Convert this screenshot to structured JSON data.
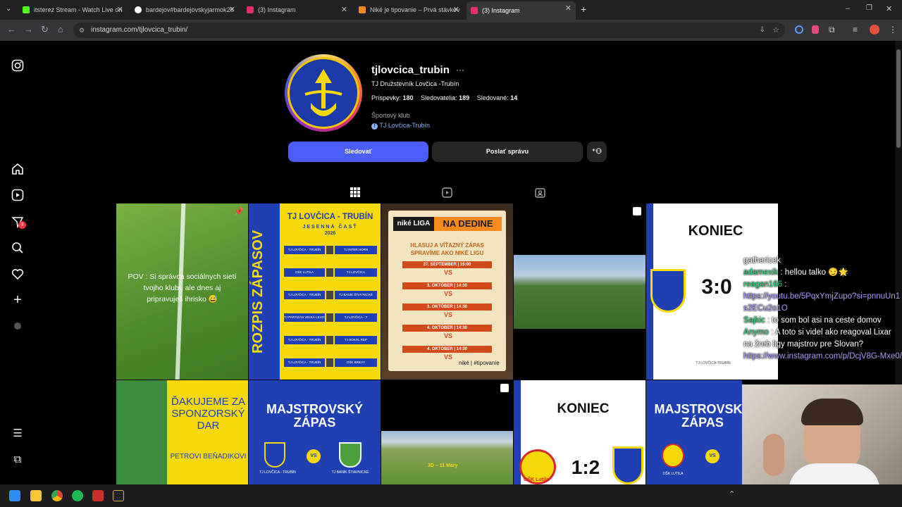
{
  "tabs": [
    {
      "label": "itsterez Stream - Watch Live on",
      "color": "#53fc18"
    },
    {
      "label": "bardejov#bardejovskyjarmok20",
      "color": "#ffffff"
    },
    {
      "label": "(3) Instagram",
      "color": "#e1306c"
    },
    {
      "label": "Niké je tipovanie – Prvá stávkov",
      "color": "#f58b1f"
    },
    {
      "label": "(3) Instagram",
      "color": "#e1306c"
    }
  ],
  "browser": {
    "url": "instagram.com/tjlovcica_trubin/"
  },
  "profile": {
    "username": "tjlovcica_trubin",
    "more": "···",
    "full_name": "TJ Družstevník Lovčica -Trubín",
    "posts_label": "Príspevky:",
    "posts_count": "180",
    "followers_label": "Sledovatelia:",
    "followers_count": "189",
    "following_label": "Sledované:",
    "following_count": "14",
    "category": "Športový klub",
    "link": "TJ Lovčica-Trubín",
    "follow_btn": "Sledovať",
    "message_btn": "Poslať správu"
  },
  "posts": {
    "p1": "POV : Si správca sociálnych sietí tvojho klubu ale dnes aj pripravuješ ihrisko 😅",
    "p2_title": "TJ LOVČICA - TRUBÍN",
    "p2_sub1": "JESENNÁ ČASŤ",
    "p2_sub2": "2026",
    "p2_side": "ROZPIS ZÁPASOV",
    "p2_matches": [
      {
        "home": "TJ LOVČICA - TRUBÍN",
        "away": "TJ INTER HORN"
      },
      {
        "home": "OŠK LUTILA",
        "away": "TJ LOVČICA"
      },
      {
        "home": "TJ LOVČICA - TRUBÍN",
        "away": "TJ BANÍK ŠTIAVNICKÉ"
      },
      {
        "home": "TJ PARTIZÁN VEĽKÁ LEHOTA",
        "away": "TJ LOVČICA - T"
      },
      {
        "home": "TJ LOVČICA - TRUBÍN",
        "away": "TJ SOKOL REP"
      },
      {
        "home": "TJ LOVČICA - TRUBÍN",
        "away": "OŠK BREHY"
      }
    ],
    "p3_brand": "niké LIGA",
    "p3_title": "NA DEDINE",
    "p3_sub": "HLASUJ A VÍŤAZNÝ ZÁPAS SPRAVÍME AKO NIKÉ LIGU",
    "p3_dates": [
      "27. SEPTEMBER | 15:00",
      "3. OKTÓBER | 14:30",
      "3. OKTÓBER | 14:30",
      "4. OKTÓBER | 14:30",
      "4. OKTÓBER | 14:30"
    ],
    "p3_footer": "niké | #tipovanie",
    "p5_title": "KONIEC",
    "p5_score": "3:0",
    "p5_club": "TJ LOVČICA-TRUBÍN",
    "p6_title": "ĎAKUJEME ZA SPONZORSKÝ DAR",
    "p6_name": "PETROVI BEŇADIKOVI",
    "p7_title": "MAJSTROVSKÝ ZÁPAS",
    "p7_vs": "VS",
    "p7_home": "TJ LOVČICA - TRUBÍN",
    "p7_away": "TJ BANÍK ŠTIAVNICKÉ",
    "p8_overlay": "3D – 11 Mary",
    "p9_title": "KONIEC",
    "p9_score": "1:2",
    "p9_club": "OŠK Lutila",
    "p10_title": "MAJSTROVSKÝ ZÁPAS",
    "p10_home": "OŠK LUTILA",
    "p10_vs": "VS"
  },
  "chat": [
    {
      "user": "",
      "text": "gathericek"
    },
    {
      "user": "adamexik",
      "text": ": hellou talko 😏🌟"
    },
    {
      "user": "reagan166",
      "text": ":",
      "link": "https://youtu.be/5PqxYmjZupo?si=pnnuUn1s2ECu2o1O"
    },
    {
      "user": "Sajkic",
      "text": ": to som bol asi na ceste domov"
    },
    {
      "user": "Anymo",
      "text": ": A toto si videl ako reagoval Lixar na žreb ligy majstrov pre Slovan?"
    },
    {
      "user": "",
      "text": "",
      "link": "https://www.instagram.com/p/DcjV8G-Mxe0/"
    }
  ],
  "colors": {
    "follow": "#4a5df9",
    "secondary": "#262626",
    "club_blue": "#1f3fb3",
    "club_yellow": "#f5d90a"
  }
}
